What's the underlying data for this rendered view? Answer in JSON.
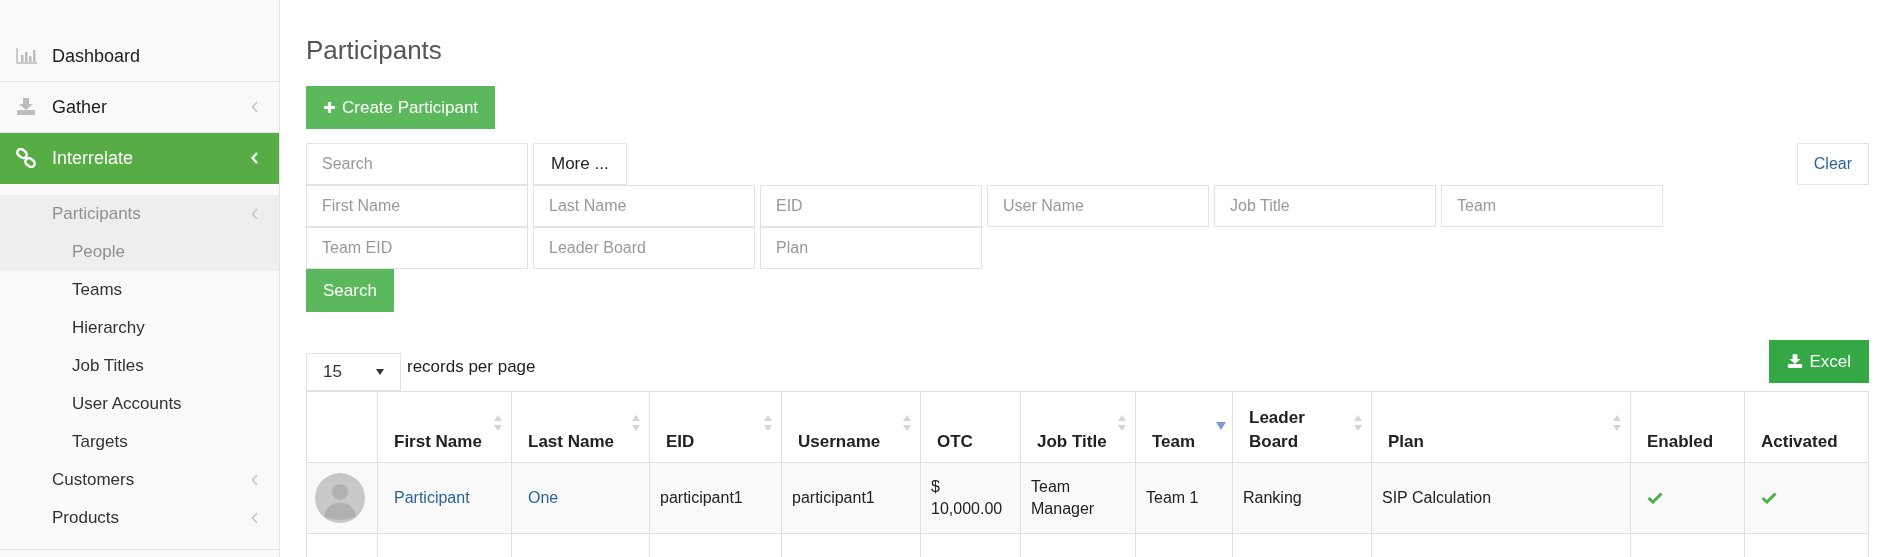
{
  "sidebar": {
    "items": [
      {
        "label": "Dashboard",
        "selected": false,
        "has_submenu": false
      },
      {
        "label": "Gather",
        "selected": false,
        "has_submenu": true
      },
      {
        "label": "Interrelate",
        "selected": true,
        "has_submenu": true,
        "children": [
          {
            "label": "Participants",
            "selected": true,
            "has_submenu": true,
            "children": [
              {
                "label": "People",
                "selected": true
              },
              {
                "label": "Teams",
                "selected": false
              },
              {
                "label": "Hierarchy",
                "selected": false
              },
              {
                "label": "Job Titles",
                "selected": false
              },
              {
                "label": "User Accounts",
                "selected": false
              },
              {
                "label": "Targets",
                "selected": false
              }
            ]
          },
          {
            "label": "Customers",
            "selected": false,
            "has_submenu": true
          },
          {
            "label": "Products",
            "selected": false,
            "has_submenu": true
          }
        ]
      }
    ]
  },
  "page_title": "Participants",
  "create_button": "Create Participant",
  "search": {
    "placeholder": "Search",
    "more_button": "More ...",
    "clear_button": "Clear"
  },
  "filters": [
    {
      "placeholder": "First Name"
    },
    {
      "placeholder": "Last Name"
    },
    {
      "placeholder": "EID"
    },
    {
      "placeholder": "User Name"
    },
    {
      "placeholder": "Job Title"
    },
    {
      "placeholder": "Team"
    },
    {
      "placeholder": "Team EID"
    },
    {
      "placeholder": "Leader Board"
    },
    {
      "placeholder": "Plan"
    }
  ],
  "search_button": "Search",
  "page_size": {
    "value": "15",
    "label": "records per page"
  },
  "excel_button": "Excel",
  "table": {
    "columns": [
      {
        "kind": "avatar"
      },
      {
        "label": "First Name",
        "sortable": true,
        "sorted": false
      },
      {
        "label": "Last Name",
        "sortable": true,
        "sorted": false
      },
      {
        "label": "EID",
        "sortable": true,
        "sorted": false
      },
      {
        "label": "Username",
        "sortable": true,
        "sorted": false
      },
      {
        "label": "OTC",
        "sortable": false,
        "sorted": false
      },
      {
        "label": "Job Title",
        "sortable": true,
        "sorted": false
      },
      {
        "label": "Team",
        "sortable": true,
        "sorted": true
      },
      {
        "label": "Leader Board",
        "sortable": true,
        "sorted": false
      },
      {
        "label": "Plan",
        "sortable": true,
        "sorted": false
      },
      {
        "label": "Enabled"
      },
      {
        "label": "Activated"
      }
    ],
    "rows": [
      {
        "first_name": "Participant",
        "last_name": "One",
        "eid": "participant1",
        "username": "participant1",
        "otc": "$ 10,000.00",
        "job_title": "Team Manager",
        "team": "Team 1",
        "leader_board": "Ranking",
        "plan": "SIP Calculation",
        "enabled": true,
        "activated": true
      }
    ]
  }
}
